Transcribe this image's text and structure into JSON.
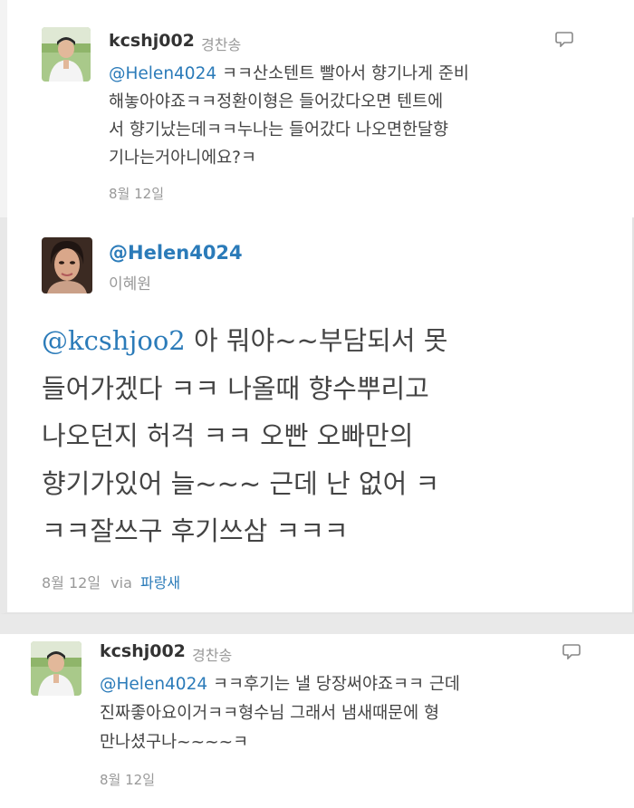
{
  "tweets": [
    {
      "username": "kcshj002",
      "realname": "경찬송",
      "mention": "@Helen4024",
      "lines": [
        " ㅋㅋ산소텐트 빨아서 향기나게 준비",
        "해놓아야죠ㅋㅋ정환이형은 들어갔다오면 텐트에",
        "서 향기났는데ㅋㅋ누나는 들어갔다 나오면한달향",
        "기나는거아니에요?ㅋ"
      ],
      "date": "8월 12일"
    },
    {
      "username": "@Helen4024",
      "realname": "이혜원",
      "mention": "@kcshjoo2",
      "lines": [
        " 아 뭐야~~부담되서 못",
        "들어가겠다 ㅋㅋ 나올때 향수뿌리고",
        "나오던지 허걱 ㅋㅋ 오빤 오빠만의",
        "향기가있어 늘~~~ 근데 난 없어 ㅋ",
        "ㅋㅋ잘쓰구 후기쓰삼 ㅋㅋㅋ"
      ],
      "date": "8월 12일",
      "via": "via",
      "via_link": "파랑새"
    },
    {
      "username": "kcshj002",
      "realname": "경찬송",
      "mention": "@Helen4024",
      "lines": [
        " ㅋㅋ후기는 낼 당장써야죠ㅋㅋ 근데",
        "진짜좋아요이거ㅋㅋ형수님 그래서 냄새때문에 형",
        "만나셨구나~~~~ㅋ"
      ],
      "date": "8월 12일"
    }
  ],
  "icons": {
    "reply": "speech-bubble-icon"
  },
  "colors": {
    "link": "#2b7bb9",
    "muted": "#999999"
  }
}
